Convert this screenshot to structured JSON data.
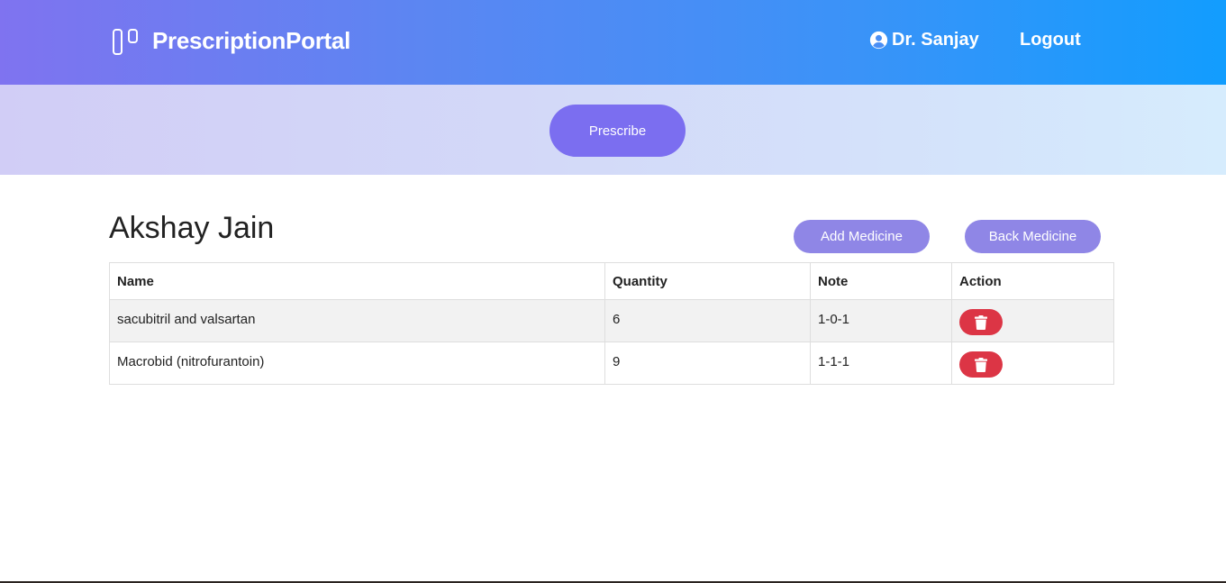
{
  "navbar": {
    "brand": "PrescriptionPortal",
    "user_name": "Dr. Sanjay",
    "logout_label": "Logout"
  },
  "band": {
    "prescribe_label": "Prescribe"
  },
  "patient": {
    "name": "Akshay Jain"
  },
  "actions": {
    "add_medicine_label": "Add Medicine",
    "back_medicine_label": "Back Medicine"
  },
  "table": {
    "headers": [
      "Name",
      "Quantity",
      "Note",
      "Action"
    ],
    "rows": [
      {
        "name": "sacubitril and valsartan",
        "quantity": "6",
        "note": "1-0-1"
      },
      {
        "name": "Macrobid (nitrofurantoin)",
        "quantity": "9",
        "note": "1-1-1"
      }
    ]
  },
  "colors": {
    "nav_gradient_start": "#7f73f0",
    "nav_gradient_end": "#129dfe",
    "prescribe_button": "#7b6ef0",
    "secondary_button": "#8f86e6",
    "delete_button": "#dc3545"
  },
  "icons": {
    "brand": "kanban-icon",
    "user": "user-circle-icon",
    "delete": "trash-icon"
  }
}
